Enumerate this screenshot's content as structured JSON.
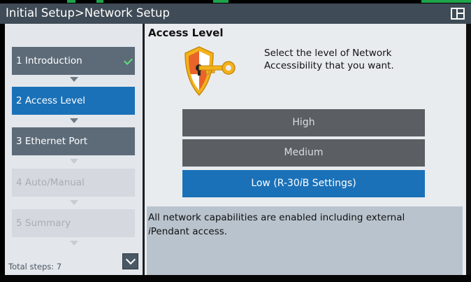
{
  "window": {
    "title": "Initial Setup>Network Setup"
  },
  "sidebar": {
    "steps": [
      {
        "label": "1  Introduction",
        "state": "done"
      },
      {
        "label": "2  Access Level",
        "state": "current"
      },
      {
        "label": "3  Ethernet Port",
        "state": "pending"
      },
      {
        "label": "4  Auto/Manual",
        "state": "future"
      },
      {
        "label": "5  Summary",
        "state": "future"
      }
    ],
    "total_steps": "Total steps: 7"
  },
  "content": {
    "title": "Access Level",
    "instructions": "Select the level of Network Accessibility that you want.",
    "levels": [
      {
        "label": "High",
        "selected": false
      },
      {
        "label": "Medium",
        "selected": false
      },
      {
        "label_prefix": "Low (R-30",
        "label_italic": "i",
        "label_suffix": "B Settings)",
        "selected": true
      }
    ],
    "description_line1": "All network capabilities are enabled including external",
    "description_italic": "i",
    "description_line2": "Pendant access."
  },
  "colors": {
    "accent_blue": "#1a71b8",
    "titlebar": "#3f4b56",
    "button_gray": "#5b5f63",
    "shield_gold": "#f3b21a",
    "shield_orange": "#e8642a"
  },
  "icons": [
    "panel-layout-icon",
    "check-icon",
    "shield-key-icon",
    "chevron-down-icon"
  ]
}
